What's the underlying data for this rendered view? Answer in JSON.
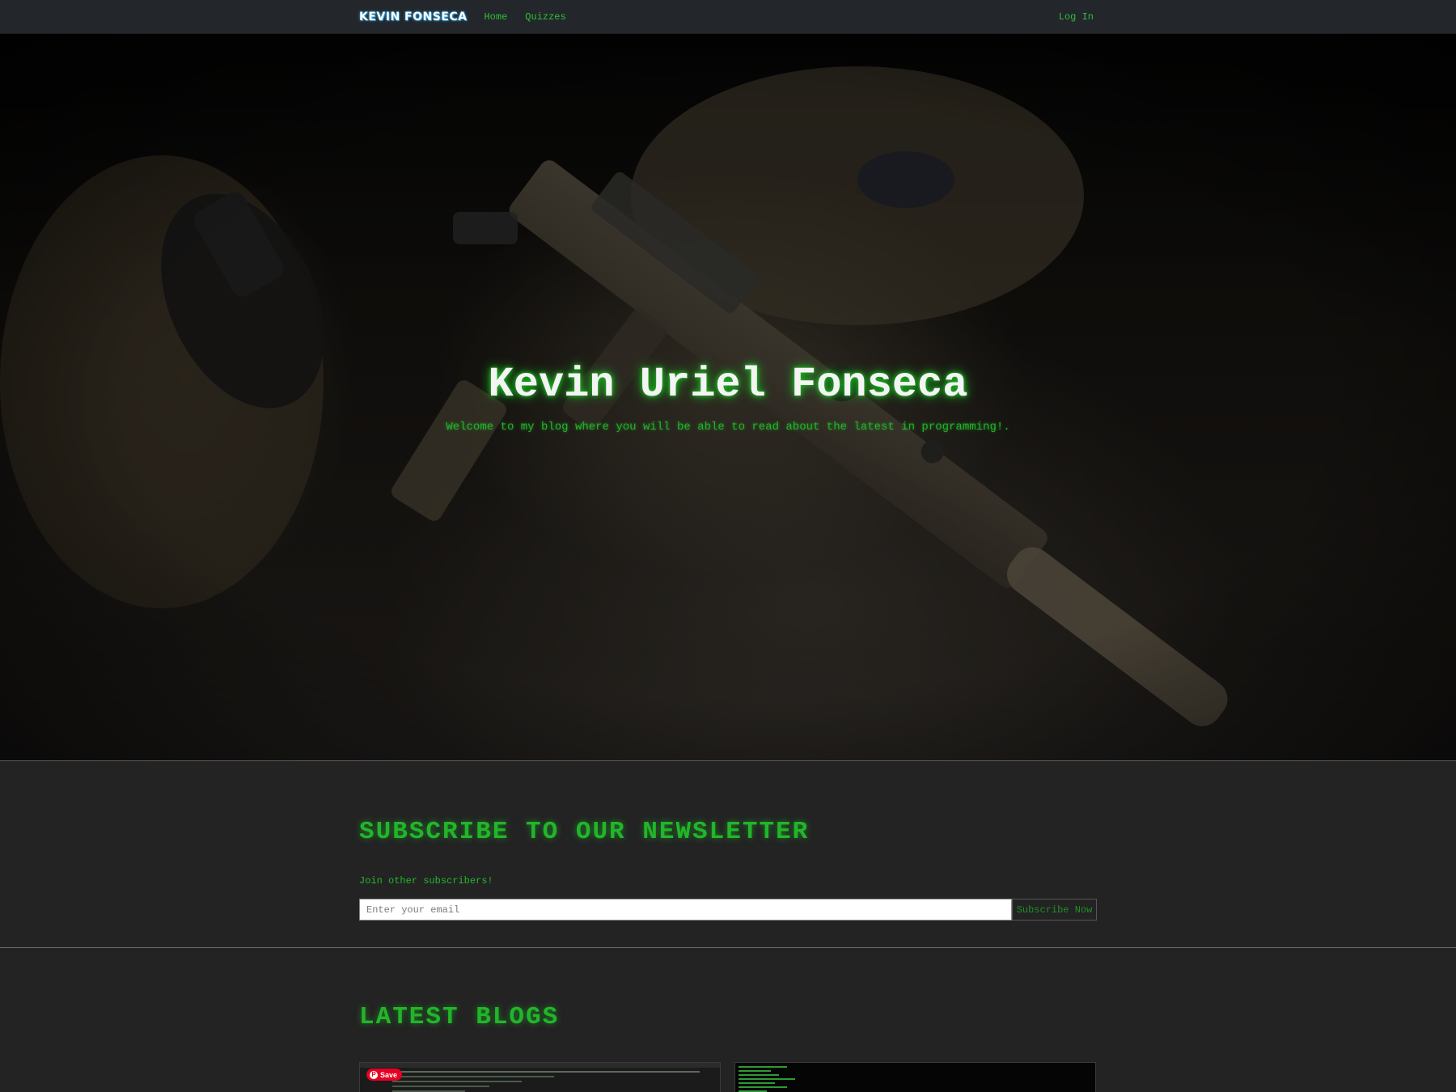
{
  "navbar": {
    "brand": "Kevin Fonseca",
    "links": [
      "Home",
      "Quizzes"
    ],
    "login": "Log In"
  },
  "hero": {
    "title": "Kevin Uriel Fonseca",
    "subtitle": "Welcome to my blog where you will be able to read about the latest in programming!."
  },
  "newsletter": {
    "title": "SUBSCRIBE TO OUR NEWSLETTER",
    "join_text": "Join other subscribers!",
    "email_placeholder": "Enter your email",
    "button": "Subscribe Now"
  },
  "blogs": {
    "title": "LATEST BLOGS",
    "save_label": "Save"
  },
  "colors": {
    "accent_green": "#22b52a",
    "background": "#232323",
    "navbar": "#23272b",
    "pinterest_red": "#e60023"
  }
}
